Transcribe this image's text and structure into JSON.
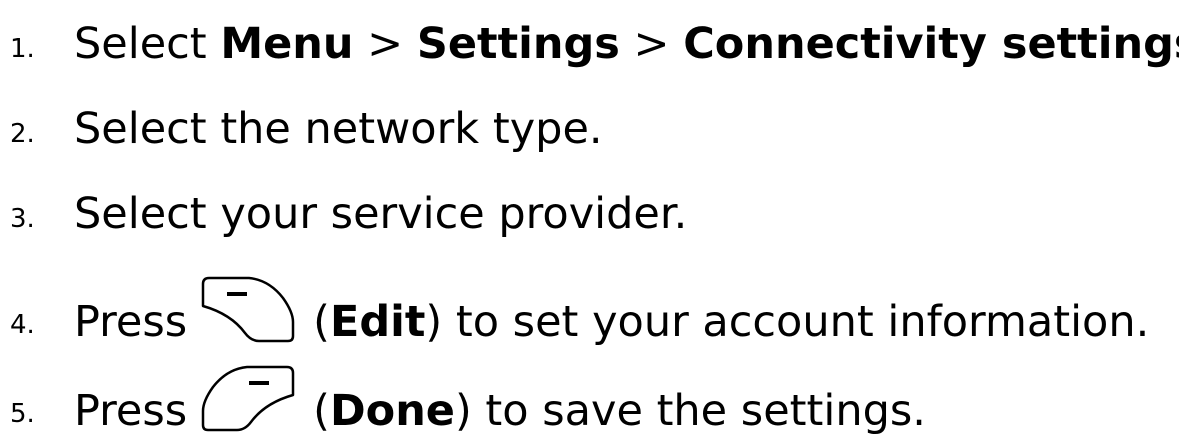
{
  "steps": [
    {
      "number": "1.",
      "parts": [
        "Select ",
        "Menu",
        " > ",
        "Settings",
        " > ",
        "Connectivity settings",
        "."
      ]
    },
    {
      "number": "2.",
      "text": "Select the network type."
    },
    {
      "number": "3.",
      "text": "Select your service provider."
    },
    {
      "number": "4.",
      "before": "Press",
      "key_icon": "left-softkey-icon",
      "open_paren": "(",
      "key_label": "Edit",
      "after": ") to set your account information."
    },
    {
      "number": "5.",
      "before": "Press",
      "key_icon": "right-softkey-icon",
      "open_paren": "(",
      "key_label": "Done",
      "after": ") to save the settings."
    }
  ]
}
